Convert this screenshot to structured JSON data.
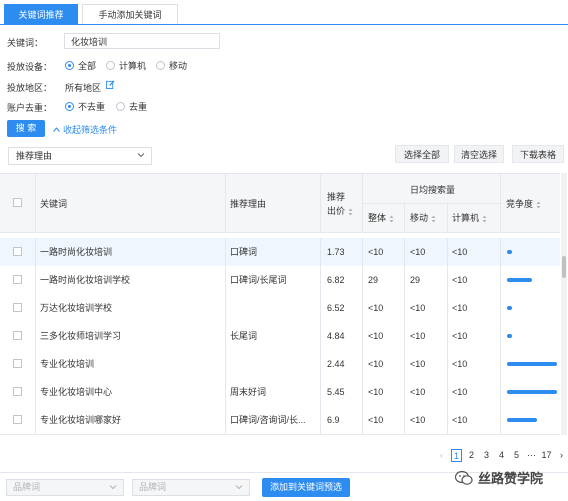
{
  "tabs": [
    {
      "label": "关键词推荐",
      "active": true
    },
    {
      "label": "手动添加关键词",
      "active": false
    }
  ],
  "filters": {
    "keyword_label": "关键词：",
    "keyword_value": "化妆培训",
    "device_label": "投放设备：",
    "device_options": [
      "全部",
      "计算机",
      "移动"
    ],
    "device_selected": "全部",
    "region_label": "投放地区：",
    "region_value": "所有地区",
    "dedup_label": "账户去重：",
    "dedup_options": [
      "不去重",
      "去重"
    ],
    "dedup_selected": "不去重",
    "search_label": "搜 索",
    "collapse_label": "收起筛选条件"
  },
  "toolbar": {
    "reason_select": "推荐理由",
    "select_all": "选择全部",
    "clear_selection": "清空选择",
    "download_table": "下载表格"
  },
  "table": {
    "headers": {
      "keyword": "关键词",
      "reason": "推荐理由",
      "bid_line1": "推荐",
      "bid_line2": "出价",
      "daily_search": "日均搜索量",
      "overall": "整体",
      "mobile": "移动",
      "computer": "计算机",
      "competition": "竞争度"
    },
    "rows": [
      {
        "keyword": "一路时尚化妆培训",
        "reason": "口碑词",
        "bid": "1.73",
        "overall": "<10",
        "mobile": "<10",
        "computer": "<10",
        "competition": 0.1
      },
      {
        "keyword": "一路时尚化妆培训学校",
        "reason": "口碑词/长尾词",
        "bid": "6.82",
        "overall": "29",
        "mobile": "29",
        "computer": "<10",
        "competition": 0.5
      },
      {
        "keyword": "万达化妆培训学校",
        "reason": "",
        "bid": "6.52",
        "overall": "<10",
        "mobile": "<10",
        "computer": "<10",
        "competition": 0.1
      },
      {
        "keyword": "三多化妆师培训学习",
        "reason": "长尾词",
        "bid": "4.84",
        "overall": "<10",
        "mobile": "<10",
        "computer": "<10",
        "competition": 0.1
      },
      {
        "keyword": "专业化妆培训",
        "reason": "",
        "bid": "2.44",
        "overall": "<10",
        "mobile": "<10",
        "computer": "<10",
        "competition": 1.0
      },
      {
        "keyword": "专业化妆培训中心",
        "reason": "周末好词",
        "bid": "5.45",
        "overall": "<10",
        "mobile": "<10",
        "computer": "<10",
        "competition": 1.0
      },
      {
        "keyword": "专业化妆培训哪家好",
        "reason": "口碑词/咨询词/长...",
        "bid": "6.9",
        "overall": "<10",
        "mobile": "<10",
        "computer": "<10",
        "competition": 0.6
      }
    ]
  },
  "pagination": {
    "pages": [
      "1",
      "2",
      "3",
      "4",
      "5",
      "···",
      "17"
    ],
    "current": "1"
  },
  "footer": {
    "select1": "品牌词",
    "select2": "品牌词",
    "add_button": "添加到关键词预选"
  },
  "watermark": "丝路赞学院",
  "colors": {
    "accent": "#2d8cf0"
  }
}
